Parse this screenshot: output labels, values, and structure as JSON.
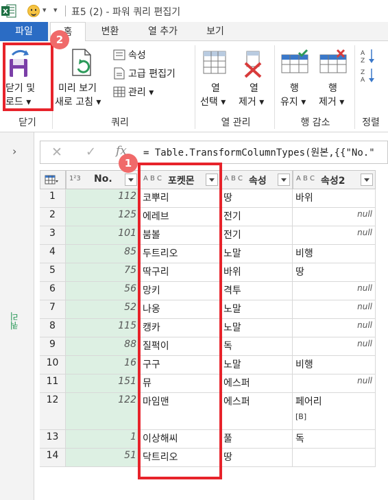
{
  "window": {
    "title": "표5 (2) - 파워 쿼리 편집기"
  },
  "tabs": [
    {
      "label": "파일"
    },
    {
      "label": "홈"
    },
    {
      "label": "변환"
    },
    {
      "label": "열 추가"
    },
    {
      "label": "보기"
    }
  ],
  "ribbon": {
    "close_load": {
      "line1": "닫기 및",
      "line2": "로드 ▾"
    },
    "preview_refresh": {
      "line1": "미리 보기",
      "line2": "새로 고침 ▾"
    },
    "properties": "속성",
    "advanced_editor": "고급 편집기",
    "manage": "관리 ▾",
    "choose_columns": {
      "line1": "열",
      "line2": "선택 ▾"
    },
    "remove_columns": {
      "line1": "열",
      "line2": "제거 ▾"
    },
    "keep_rows": {
      "line1": "행",
      "line2": "유지 ▾"
    },
    "remove_rows": {
      "line1": "행",
      "line2": "제거 ▾"
    },
    "groups": {
      "close": "닫기",
      "query": "쿼리",
      "manage_columns": "열 관리",
      "reduce_rows": "행 감소",
      "sort": "정렬"
    }
  },
  "side_pane": {
    "label": "쿼리"
  },
  "formula": {
    "fx": "fx",
    "text": "= Table.TransformColumnTypes(원본,{{\"No.\""
  },
  "columns": [
    {
      "label": "No.",
      "type": "1²3"
    },
    {
      "label": "포켓몬",
      "type": "A B C"
    },
    {
      "label": "속성",
      "type": "A B C"
    },
    {
      "label": "속성2",
      "type": "A B C"
    }
  ],
  "rows": [
    {
      "idx": "1",
      "no": "112",
      "name": "코뿌리",
      "attr": "땅",
      "attr2": "바위"
    },
    {
      "idx": "2",
      "no": "125",
      "name": "에레브",
      "attr": "전기",
      "attr2": "null"
    },
    {
      "idx": "3",
      "no": "101",
      "name": "붐볼",
      "attr": "전기",
      "attr2": "null"
    },
    {
      "idx": "4",
      "no": "85",
      "name": "두트리오",
      "attr": "노말",
      "attr2": "비행"
    },
    {
      "idx": "5",
      "no": "75",
      "name": "딱구리",
      "attr": "바위",
      "attr2": "땅"
    },
    {
      "idx": "6",
      "no": "56",
      "name": "망키",
      "attr": "격투",
      "attr2": "null"
    },
    {
      "idx": "7",
      "no": "52",
      "name": "나옹",
      "attr": "노말",
      "attr2": "null"
    },
    {
      "idx": "8",
      "no": "115",
      "name": "캥카",
      "attr": "노말",
      "attr2": "null"
    },
    {
      "idx": "9",
      "no": "88",
      "name": "질퍽이",
      "attr": "독",
      "attr2": "null"
    },
    {
      "idx": "10",
      "no": "16",
      "name": "구구",
      "attr": "노말",
      "attr2": "비행"
    },
    {
      "idx": "11",
      "no": "151",
      "name": "뮤",
      "attr": "에스퍼",
      "attr2": "null"
    },
    {
      "idx": "12",
      "no": "122",
      "name": "마임맨",
      "attr": "에스퍼",
      "attr2": "페어리",
      "attr2_sub": "[B]"
    },
    {
      "idx": "13",
      "no": "1",
      "name": "이상해씨",
      "attr": "풀",
      "attr2": "독"
    },
    {
      "idx": "14",
      "no": "51",
      "name": "닥트리오",
      "attr": "땅",
      "attr2": ""
    }
  ],
  "badges": {
    "one": "1",
    "two": "2"
  },
  "colors": {
    "file_tab": "#2b6cc4",
    "highlight": "#e7232b",
    "badge": "#f06a6a",
    "no_column": "#ddf0e3"
  }
}
